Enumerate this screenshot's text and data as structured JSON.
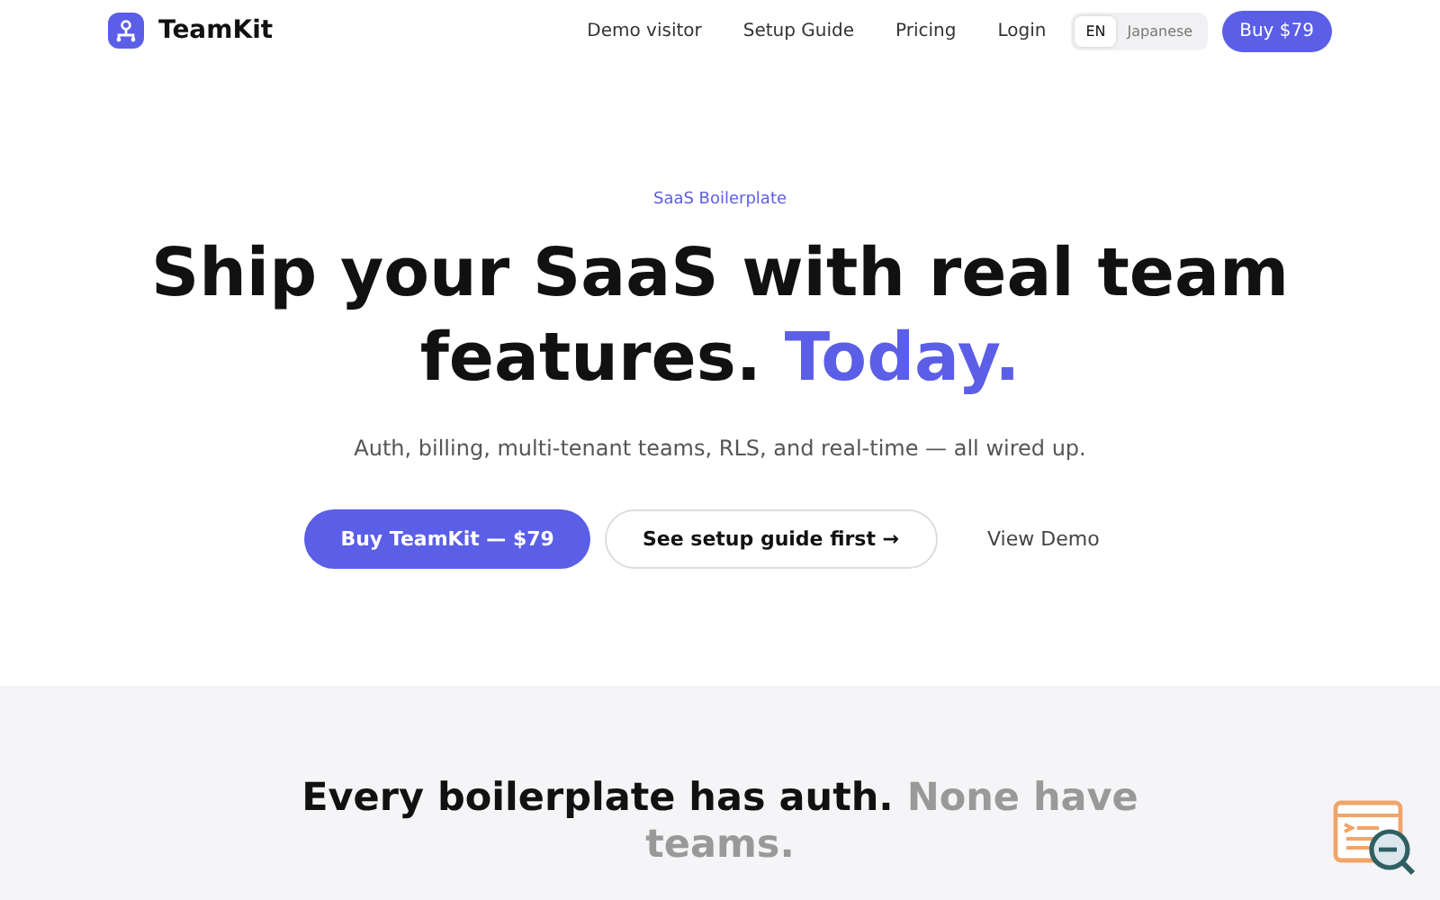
{
  "brand": {
    "name": "TeamKit"
  },
  "nav": {
    "links": [
      "Demo visitor",
      "Setup Guide",
      "Pricing",
      "Login"
    ],
    "languages": [
      {
        "label": "EN",
        "selected": true
      },
      {
        "label": "Japanese",
        "selected": false
      }
    ],
    "cta": "Buy $79"
  },
  "hero": {
    "eyebrow": "SaaS Boilerplate",
    "headline": "Ship your SaaS with real team features. ",
    "headline_accent": "Today.",
    "subtitle": "Auth, billing, multi-tenant teams, RLS, and real-time — all wired up.",
    "buttons": [
      {
        "kind": "primary",
        "label": "Buy TeamKit — $79"
      },
      {
        "kind": "outline",
        "label": "See setup guide first →"
      },
      {
        "kind": "plain",
        "label": "View Demo"
      }
    ]
  },
  "section": {
    "heading": "Every boilerplate has auth. ",
    "heading_muted": "None have teams."
  }
}
